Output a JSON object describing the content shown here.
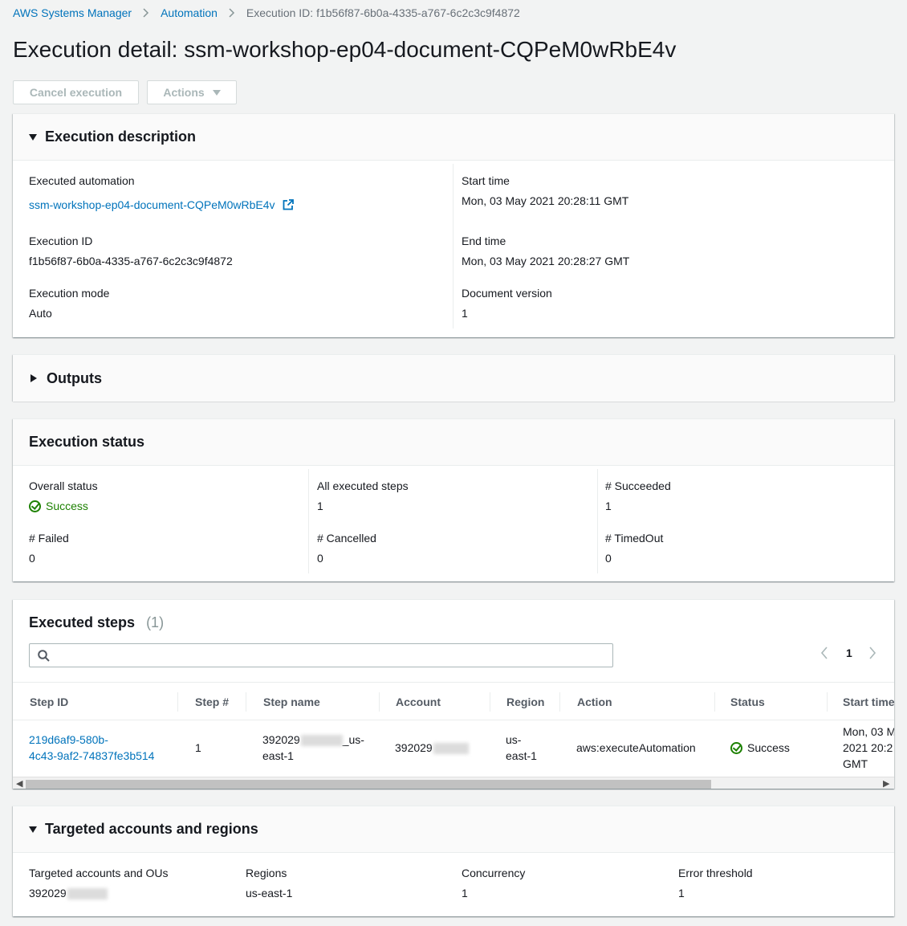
{
  "breadcrumb": {
    "root": "AWS Systems Manager",
    "section": "Automation",
    "current": "Execution ID: f1b56f87-6b0a-4335-a767-6c2c3c9f4872"
  },
  "page_title": "Execution detail: ssm-workshop-ep04-document-CQPeM0wRbE4v",
  "toolbar": {
    "cancel_label": "Cancel execution",
    "actions_label": "Actions"
  },
  "execution_description": {
    "title": "Execution description",
    "executed_automation_label": "Executed automation",
    "executed_automation_value": "ssm-workshop-ep04-document-CQPeM0wRbE4v",
    "execution_id_label": "Execution ID",
    "execution_id_value": "f1b56f87-6b0a-4335-a767-6c2c3c9f4872",
    "execution_mode_label": "Execution mode",
    "execution_mode_value": "Auto",
    "start_time_label": "Start time",
    "start_time_value": "Mon, 03 May 2021 20:28:11 GMT",
    "end_time_label": "End time",
    "end_time_value": "Mon, 03 May 2021 20:28:27 GMT",
    "document_version_label": "Document version",
    "document_version_value": "1"
  },
  "outputs": {
    "title": "Outputs"
  },
  "execution_status": {
    "title": "Execution status",
    "overall_status_label": "Overall status",
    "overall_status_value": "Success",
    "all_steps_label": "All executed steps",
    "all_steps_value": "1",
    "succeeded_label": "# Succeeded",
    "succeeded_value": "1",
    "failed_label": "# Failed",
    "failed_value": "0",
    "cancelled_label": "# Cancelled",
    "cancelled_value": "0",
    "timedout_label": "# TimedOut",
    "timedout_value": "0"
  },
  "executed_steps": {
    "title": "Executed steps",
    "count": "(1)",
    "search_placeholder": "",
    "page": "1",
    "columns": [
      "Step ID",
      "Step #",
      "Step name",
      "Account",
      "Region",
      "Action",
      "Status",
      "Start time"
    ],
    "rows": [
      {
        "step_id_line1": "219d6af9-580b-",
        "step_id_line2": "4c43-9af2-74837fe3b514",
        "step_num": "1",
        "step_name_prefix": "392029",
        "step_name_suffix": "_us-",
        "step_name_line2": "east-1",
        "account_prefix": "392029",
        "region_line1": "us-",
        "region_line2": "east-1",
        "action": "aws:executeAutomation",
        "status": "Success",
        "start_line1": "Mon, 03 M",
        "start_line2": "2021 20:2",
        "start_line3": "GMT"
      }
    ]
  },
  "targeted": {
    "title": "Targeted accounts and regions",
    "accounts_label": "Targeted accounts and OUs",
    "accounts_value_prefix": "392029",
    "regions_label": "Regions",
    "regions_value": "us-east-1",
    "concurrency_label": "Concurrency",
    "concurrency_value": "1",
    "error_threshold_label": "Error threshold",
    "error_threshold_value": "1"
  },
  "colors": {
    "link": "#0073bb",
    "success": "#1d8102",
    "disabled_text": "#aab7b8"
  }
}
